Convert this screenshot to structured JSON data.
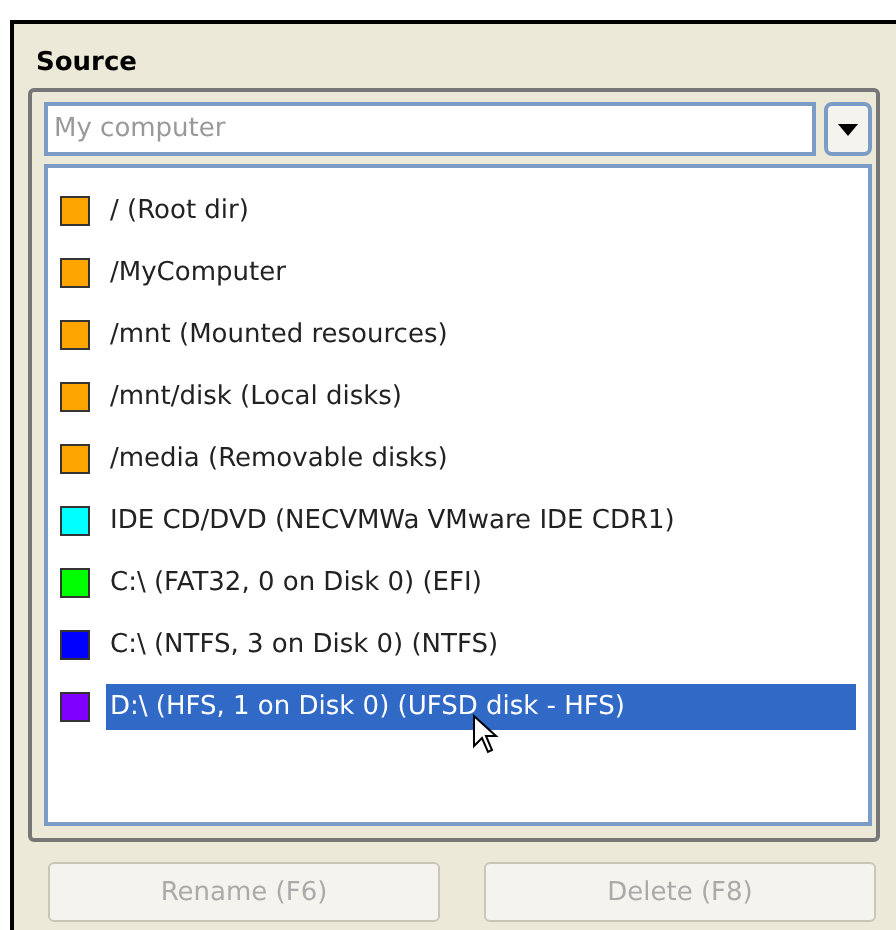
{
  "title": "Source",
  "combo": {
    "placeholder": "My computer"
  },
  "items": [
    {
      "label": "/ (Root dir)",
      "color": "#ffa500",
      "selected": false
    },
    {
      "label": "/MyComputer",
      "color": "#ffa500",
      "selected": false
    },
    {
      "label": "/mnt (Mounted resources)",
      "color": "#ffa500",
      "selected": false
    },
    {
      "label": "/mnt/disk (Local disks)",
      "color": "#ffa500",
      "selected": false
    },
    {
      "label": "/media (Removable disks)",
      "color": "#ffa500",
      "selected": false
    },
    {
      "label": "IDE CD/DVD (NECVMWa VMware IDE CDR1)",
      "color": "#00ffff",
      "selected": false
    },
    {
      "label": "C:\\  (FAT32, 0 on Disk 0) (EFI)",
      "color": "#00ff00",
      "selected": false
    },
    {
      "label": "C:\\  (NTFS, 3 on Disk 0) (NTFS)",
      "color": "#0000ff",
      "selected": false
    },
    {
      "label": "D:\\  (HFS, 1 on Disk 0) (UFSD disk - HFS)",
      "color": "#8000ff",
      "selected": true
    }
  ],
  "buttons": [
    {
      "label": "Rename (F6)",
      "disabled": true
    },
    {
      "label": "Delete (F8)",
      "disabled": true
    }
  ]
}
